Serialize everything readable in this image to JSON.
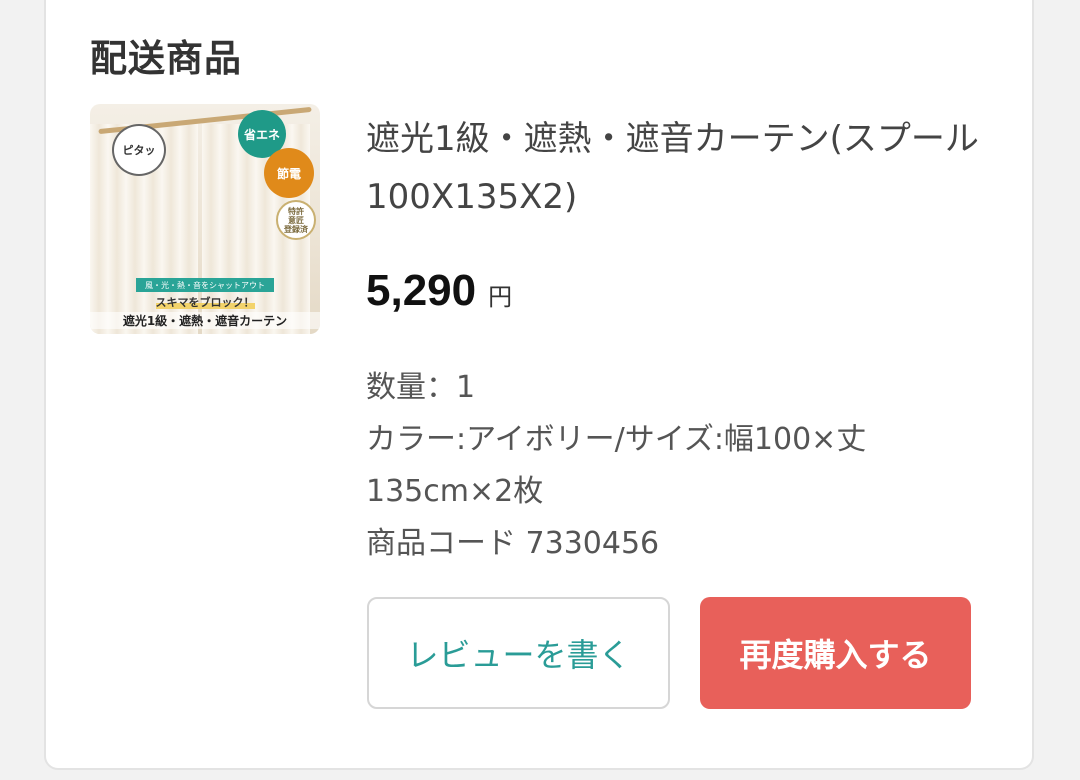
{
  "section": {
    "title": "配送商品"
  },
  "product": {
    "thumbnail": {
      "bubble_text": "ピタッ",
      "badge_green": "省エネ",
      "badge_orange": "節電",
      "seal_lines": [
        "特許",
        "意匠",
        "登録済"
      ],
      "banner_top": "風・光・熱・音をシャットアウト",
      "banner_catch": "スキマをブロック！",
      "banner_main": "遮光1級・遮熱・遮音カーテン"
    },
    "name": "遮光1級・遮熱・遮音カーテン(スプール100X135X2)",
    "price": {
      "amount": "5,290",
      "unit": "円"
    },
    "details": {
      "quantity": "数量：1",
      "variant_line1": "カラー:アイボリー/サイズ:幅100×丈",
      "variant_line2": "135cm×2枚",
      "code": "商品コード 7330456"
    }
  },
  "actions": {
    "review_label": "レビューを書く",
    "rebuy_label": "再度購入する"
  },
  "colors": {
    "accent_teal": "#2a9c97",
    "rebuy_red": "#e8605a"
  }
}
